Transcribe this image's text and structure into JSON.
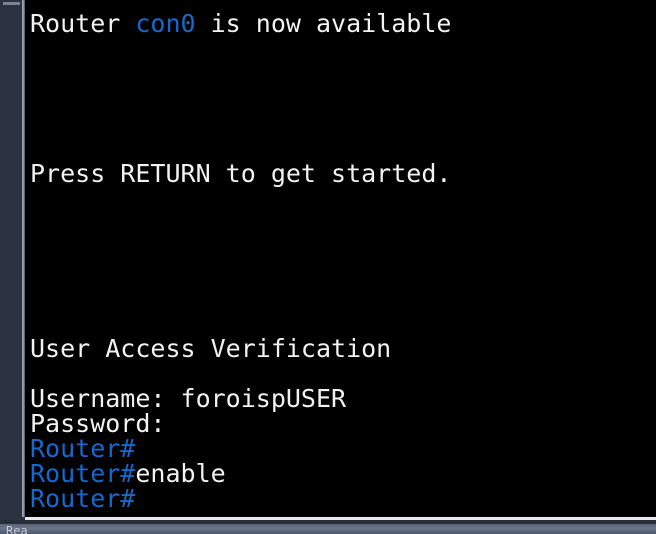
{
  "window": {
    "background_color": "#000000",
    "gutter_color": "#2b3140",
    "accent_blue": "#1668cd",
    "text_white": "#f2f2f2"
  },
  "terminal": {
    "lines": [
      {
        "id": "line-banner-available",
        "segments": [
          {
            "text": "Router ",
            "color": "white"
          },
          {
            "text": "con0",
            "color": "blue"
          },
          {
            "text": " is now available",
            "color": "white"
          }
        ]
      },
      {
        "id": "line-blank-1",
        "segments": [
          {
            "text": "",
            "color": "white"
          }
        ]
      },
      {
        "id": "line-blank-2",
        "segments": [
          {
            "text": "",
            "color": "white"
          }
        ]
      },
      {
        "id": "line-blank-3",
        "segments": [
          {
            "text": "",
            "color": "white"
          }
        ]
      },
      {
        "id": "line-blank-4",
        "segments": [
          {
            "text": "",
            "color": "white"
          }
        ]
      },
      {
        "id": "line-blank-5",
        "segments": [
          {
            "text": "",
            "color": "white"
          }
        ]
      },
      {
        "id": "line-press-return",
        "segments": [
          {
            "text": "Press RETURN to get started.",
            "color": "white"
          }
        ]
      },
      {
        "id": "line-blank-6",
        "segments": [
          {
            "text": "",
            "color": "white"
          }
        ]
      },
      {
        "id": "line-blank-7",
        "segments": [
          {
            "text": "",
            "color": "white"
          }
        ]
      },
      {
        "id": "line-blank-8",
        "segments": [
          {
            "text": "",
            "color": "white"
          }
        ]
      },
      {
        "id": "line-blank-9",
        "segments": [
          {
            "text": "",
            "color": "white"
          }
        ]
      },
      {
        "id": "line-blank-10",
        "segments": [
          {
            "text": "",
            "color": "white"
          }
        ]
      },
      {
        "id": "line-blank-11",
        "segments": [
          {
            "text": "",
            "color": "white"
          }
        ]
      },
      {
        "id": "line-user-access-verification",
        "segments": [
          {
            "text": "User Access Verification",
            "color": "white"
          }
        ]
      },
      {
        "id": "line-blank-12",
        "segments": [
          {
            "text": "",
            "color": "white"
          }
        ]
      },
      {
        "id": "line-username",
        "segments": [
          {
            "text": "Username: foroispUSER",
            "color": "white"
          }
        ]
      },
      {
        "id": "line-password",
        "segments": [
          {
            "text": "Password:",
            "color": "white"
          }
        ]
      },
      {
        "id": "line-prompt-1",
        "segments": [
          {
            "text": "Router#",
            "color": "blue"
          }
        ]
      },
      {
        "id": "line-prompt-enable",
        "segments": [
          {
            "text": "Router#",
            "color": "blue"
          },
          {
            "text": "enable",
            "color": "white"
          }
        ]
      },
      {
        "id": "line-prompt-3",
        "segments": [
          {
            "text": "Router#",
            "color": "blue"
          }
        ]
      }
    ],
    "prompt_text": "Router#",
    "last_command": "enable",
    "username_value": "foroispUSER",
    "password_value": ""
  },
  "scrollbar": {
    "orientation": "vertical",
    "thumb_position": "top"
  },
  "status_bar": {
    "clipped_text": "Rea"
  }
}
